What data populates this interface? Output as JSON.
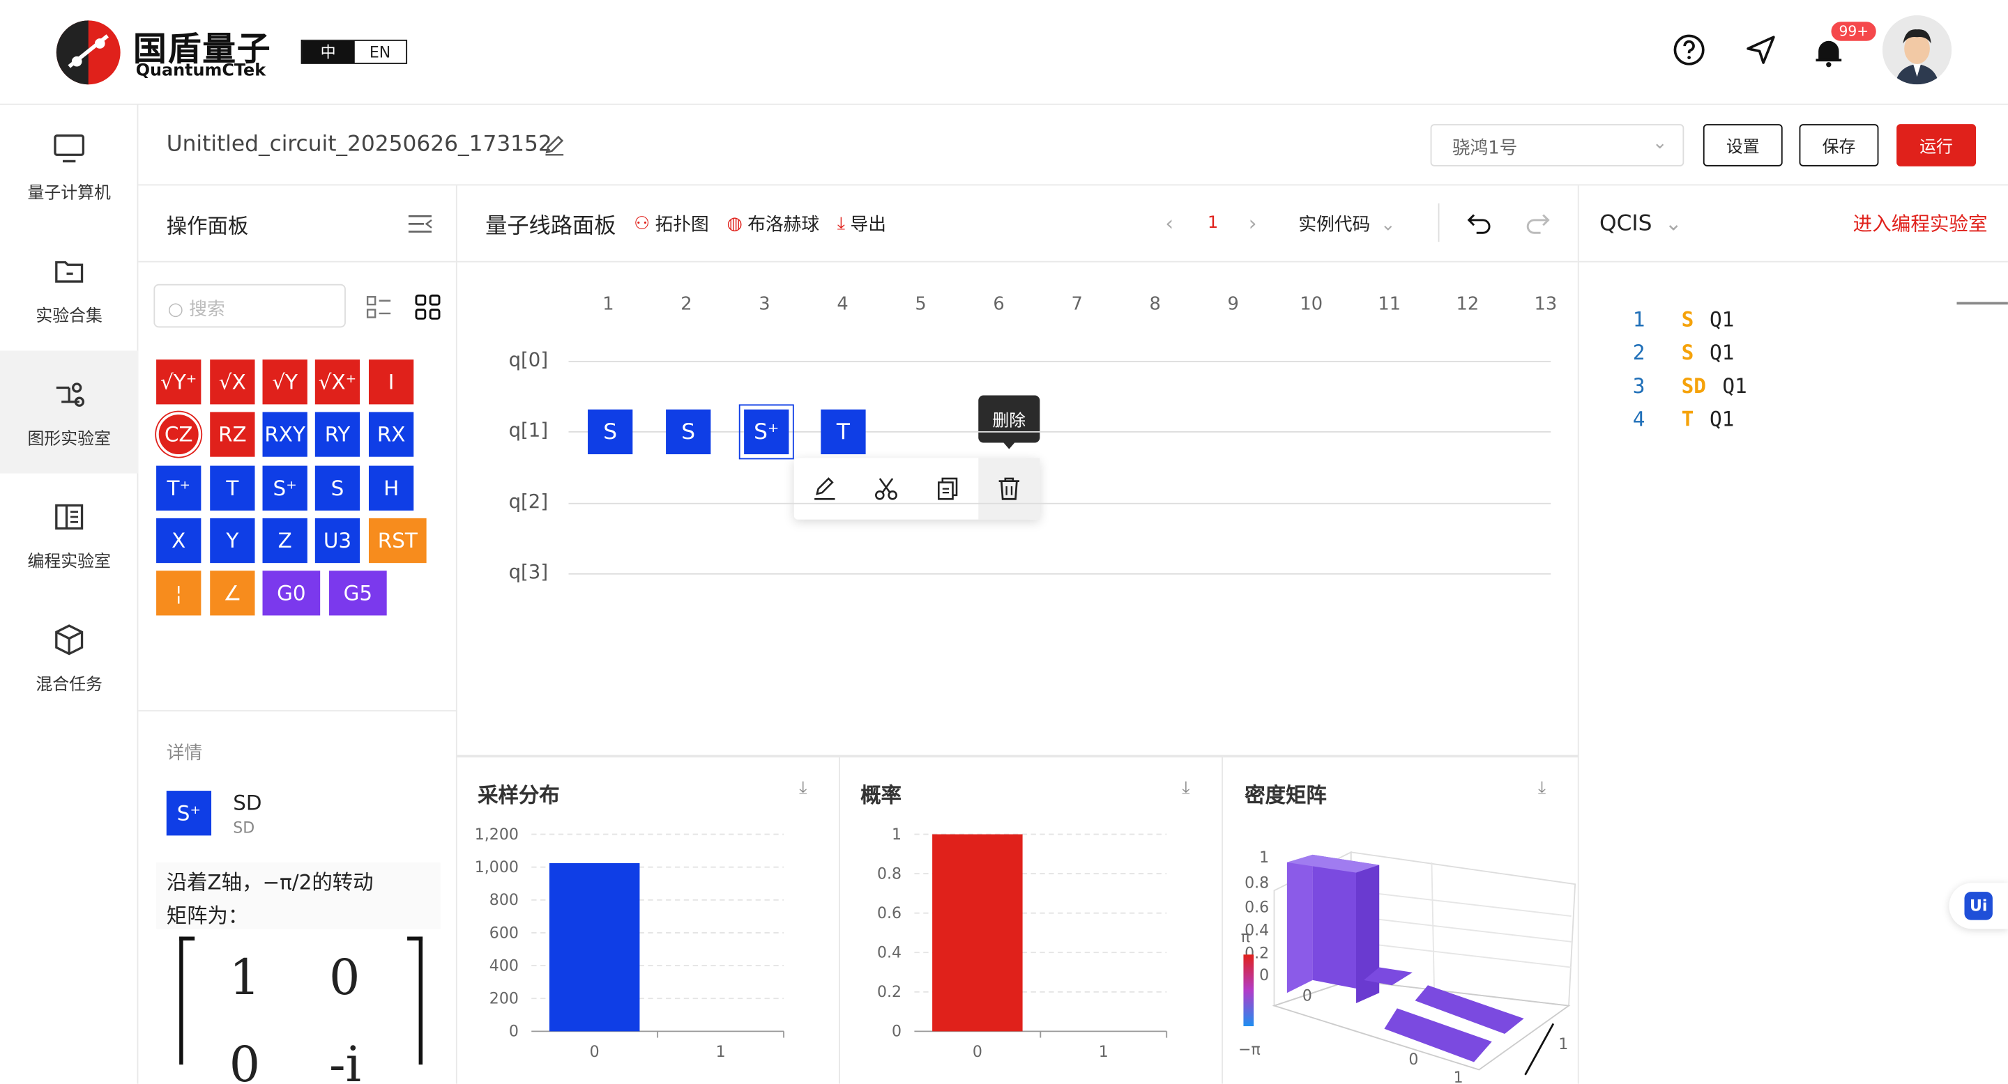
{
  "brand": {
    "name": "国盾量子",
    "sub": "QuantumCTek"
  },
  "lang": {
    "zh": "中",
    "en": "EN"
  },
  "notif_badge": "99+",
  "sidebar": {
    "items": [
      {
        "label": "量子计算机"
      },
      {
        "label": "实验合集"
      },
      {
        "label": "图形实验室"
      },
      {
        "label": "编程实验室"
      },
      {
        "label": "混合任务"
      }
    ]
  },
  "circuit_title": "Unititled_circuit_20250626_173152",
  "device_select": "骁鸿1号",
  "buttons": {
    "settings": "设置",
    "save": "保存",
    "run": "运行"
  },
  "ops_panel": {
    "title": "操作面板",
    "search_placeholder": "搜索"
  },
  "gates": [
    [
      "√Y⁺",
      "√X",
      "√Y",
      "√X⁺",
      "I"
    ],
    [
      "CZ",
      "RZ",
      "RXY",
      "RY",
      "RX"
    ],
    [
      "T⁺",
      "T",
      "S⁺",
      "S",
      "H"
    ],
    [
      "X",
      "Y",
      "Z",
      "U3",
      "RST"
    ],
    [
      "¦",
      "∠",
      "G0",
      "G5"
    ]
  ],
  "circuit_panel": {
    "title": "量子线路面板",
    "topology": "拓扑图",
    "bloch": "布洛赫球",
    "export": "导出",
    "page": "1",
    "examples": "实例代码"
  },
  "columns": [
    "1",
    "2",
    "3",
    "4",
    "5",
    "6",
    "7",
    "8",
    "9",
    "10",
    "11",
    "12",
    "13"
  ],
  "qubits": [
    "q[0]",
    "q[1]",
    "q[2]",
    "q[3]"
  ],
  "circuit_gates": [
    "S",
    "S",
    "S⁺",
    "T"
  ],
  "tooltip": "删除",
  "qcis": {
    "lang": "QCIS",
    "enter": "进入编程实验室",
    "lines": [
      {
        "n": "1",
        "op": "S",
        "arg": "Q1"
      },
      {
        "n": "2",
        "op": "S",
        "arg": "Q1"
      },
      {
        "n": "3",
        "op": "SD",
        "arg": "Q1"
      },
      {
        "n": "4",
        "op": "T",
        "arg": "Q1"
      }
    ]
  },
  "detail": {
    "title": "详情",
    "gate_symbol": "S⁺",
    "gate_name": "SD",
    "gate_sub": "SD",
    "desc1": "沿着Z轴，−π/2的转动",
    "desc2": "矩阵为：",
    "m11": "1",
    "m12": "0",
    "m21": "0",
    "m22": "-i"
  },
  "float_badge": "Ui",
  "chart_data": [
    {
      "type": "bar",
      "title": "采样分布",
      "categories": [
        "0",
        "1"
      ],
      "values": [
        1024,
        0
      ],
      "ylim": [
        0,
        1200
      ],
      "yticks": [
        "0",
        "200",
        "400",
        "600",
        "800",
        "1,000",
        "1,200"
      ],
      "color": "#0f3ee6"
    },
    {
      "type": "bar",
      "title": "概率",
      "categories": [
        "0",
        "1"
      ],
      "values": [
        1,
        0
      ],
      "ylim": [
        0,
        1
      ],
      "yticks": [
        "0",
        "0.2",
        "0.4",
        "0.6",
        "0.8",
        "1"
      ],
      "color": "#e0211b"
    },
    {
      "type": "bar3d",
      "title": "密度矩阵",
      "zticks": [
        "0",
        "0.2",
        "0.4",
        "0.6",
        "0.8",
        "1"
      ],
      "colorbar_min": "−π",
      "colorbar_max": "π",
      "axis_labels": [
        "0",
        "1",
        "0",
        "1"
      ]
    }
  ]
}
